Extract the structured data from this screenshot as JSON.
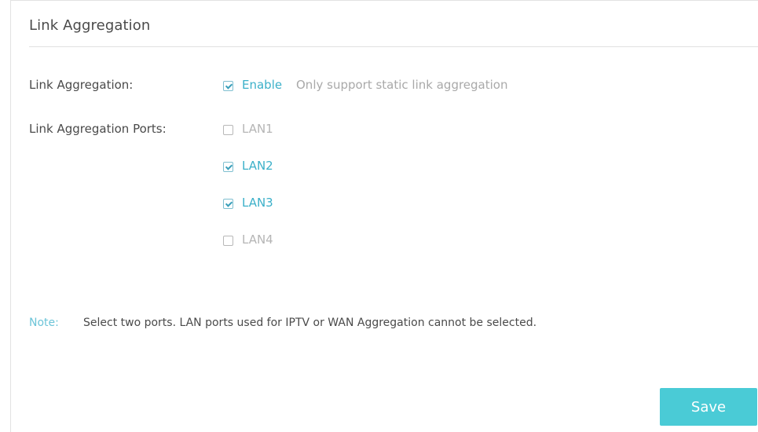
{
  "section": {
    "title": "Link Aggregation"
  },
  "link_aggregation": {
    "label": "Link Aggregation:",
    "enable_label": "Enable",
    "enable_checked": true,
    "hint": "Only support static link aggregation"
  },
  "ports": {
    "label": "Link Aggregation Ports:",
    "items": [
      {
        "label": "LAN1",
        "checked": false
      },
      {
        "label": "LAN2",
        "checked": true
      },
      {
        "label": "LAN3",
        "checked": true
      },
      {
        "label": "LAN4",
        "checked": false
      }
    ]
  },
  "note": {
    "label": "Note:",
    "text": "Select two ports. LAN ports used for IPTV or WAN Aggregation cannot be selected."
  },
  "actions": {
    "save_label": "Save"
  },
  "colors": {
    "accent": "#4acbd6",
    "checked_text": "#3bb0c9",
    "unchecked_text": "#b5b5b5"
  },
  "icons": {
    "checkbox_checked": "checkbox-checked-icon",
    "checkbox_unchecked": "checkbox-unchecked-icon"
  }
}
